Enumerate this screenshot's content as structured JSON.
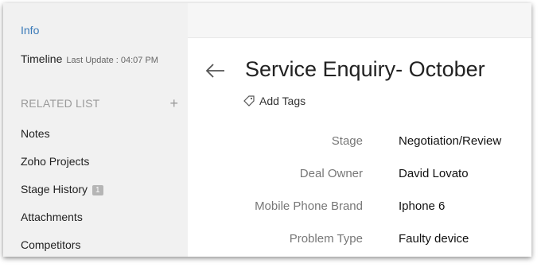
{
  "sidebar": {
    "info": "Info",
    "timeline": {
      "label": "Timeline",
      "last_update": "Last Update : 04:07 PM"
    },
    "related_list": {
      "label": "RELATED LIST",
      "add": "+"
    },
    "items": [
      {
        "label": "Notes"
      },
      {
        "label": "Zoho Projects"
      },
      {
        "label": "Stage History",
        "badge": "1"
      },
      {
        "label": "Attachments"
      },
      {
        "label": "Competitors"
      }
    ]
  },
  "record": {
    "title": "Service Enquiry- October",
    "add_tags": "Add Tags",
    "fields": [
      {
        "label": "Stage",
        "value": "Negotiation/Review"
      },
      {
        "label": "Deal Owner",
        "value": "David Lovato"
      },
      {
        "label": "Mobile Phone Brand",
        "value": "Iphone 6"
      },
      {
        "label": "Problem Type",
        "value": "Faulty device"
      }
    ]
  },
  "colors": {
    "accent": "#3a7ab8",
    "sidebar_bg": "#f1f1f1",
    "muted": "#9a9a9a",
    "badge_bg": "#b5b5b5"
  },
  "icons": [
    "back-arrow-icon",
    "tag-icon",
    "plus-icon"
  ]
}
